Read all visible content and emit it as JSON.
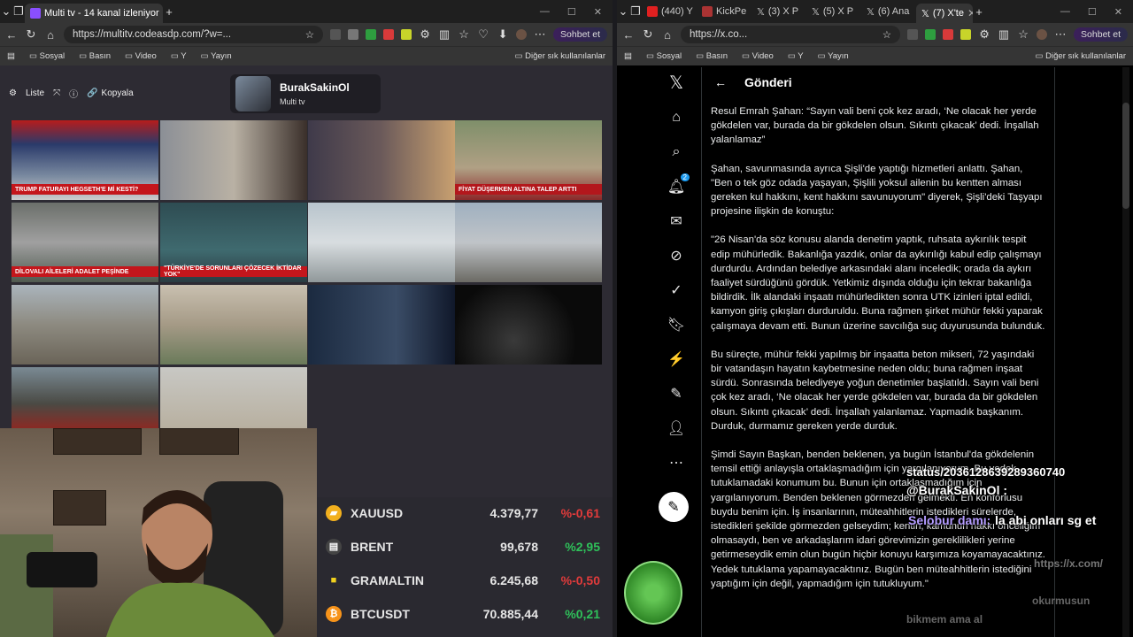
{
  "left_window": {
    "tab_title": "Multi tv - 14 kanal izleniyor",
    "url": "https://multitv.codeasdp.com/?w=...",
    "chat_label": "Sohbet et",
    "bookmarks": [
      "Sosyal",
      "Basın",
      "Video",
      "Y",
      "Yayın"
    ],
    "other_bookmarks": "Diğer sık kullanılanlar",
    "controls": {
      "list": "Liste",
      "copy": "Kopyala"
    },
    "channel": {
      "name": "BurakSakinOl",
      "subtitle": "Multi tv"
    },
    "tickers": {
      "trump": "TRUMP FATURAYI HEGSETH'E Mİ KESTİ?",
      "altin": "FİYAT DÜŞERKEN ALTINA TALEP ARTTI",
      "diloval": "DİLOVALI AİLELERİ ADALET PEŞİNDE",
      "ozel": "\"TÜRKİYE'DE SORUNLARI ÇÖZECEK İKTİDAR YOK\""
    }
  },
  "market": [
    {
      "symbol": "XAUUSD",
      "price": "4.379,77",
      "change": "%-0,61",
      "dir": "down",
      "color": "#f2b01e"
    },
    {
      "symbol": "BRENT",
      "price": "99,678",
      "change": "%2,95",
      "dir": "up",
      "color": "#dddddd"
    },
    {
      "symbol": "GRAMALTIN",
      "price": "6.245,68",
      "change": "%-0,50",
      "dir": "down",
      "color": "#f2d21e"
    },
    {
      "symbol": "BTCUSDT",
      "price": "70.885,44",
      "change": "%0,21",
      "dir": "up",
      "color": "#f7931a"
    }
  ],
  "right_window": {
    "tabs": [
      "(440) Y",
      "KickPe",
      "(3) X P",
      "(5) X P",
      "(6) Ana",
      "(7) X'te"
    ],
    "url": "https://x.co...",
    "chat_label": "Sohbet et",
    "bookmarks": [
      "Sosyal",
      "Basın",
      "Video",
      "Y",
      "Yayın"
    ],
    "other_bookmarks": "Diğer sık kullanılanlar",
    "post_header": "Gönderi",
    "paragraphs": [
      "Resul Emrah Şahan: “Sayın vali beni çok kez aradı, ‘Ne olacak her yerde gökdelen var, burada da bir gökdelen olsun. Sıkıntı çıkacak’ dedi. İnşallah yalanlamaz”",
      "Şahan, savunmasında ayrıca Şişli'de yaptığı hizmetleri anlattı. Şahan, \"Ben o tek göz odada yaşayan, Şişlili yoksul ailenin bu kentten alması gereken kul hakkını, kent hakkını savunuyorum\" diyerek, Şişli'deki Taşyapı projesine ilişkin de konuştu:",
      "\"26 Nisan'da söz konusu alanda denetim yaptık, ruhsata aykırılık tespit edip mühürledik. Bakanlığa yazdık, onlar da aykırılığı kabul edip çalışmayı durdurdu. Ardından belediye arkasındaki alanı inceledik; orada da aykırı faaliyet sürdüğünü gördük. Yetkimiz dışında olduğu için tekrar bakanlığa bildirdik. İlk alandaki inşaatı mühürledikten sonra UTK izinleri iptal edildi, kamyon giriş çıkışları durduruldu. Buna rağmen şirket mühür fekki yaparak çalışmaya devam etti. Bunun üzerine savcılığa suç duyurusunda bulunduk.",
      "Bu süreçte, mühür fekki yapılmış bir inşaatta beton mikseri, 72 yaşındaki bir vatandaşın hayatın kaybetmesine neden oldu; buna rağmen inşaat sürdü. Sonrasında belediyeye yoğun denetimler başlatıldı. Sayın vali beni çok kez aradı, ‘Ne olacak her yerde gökdelen var, burada da bir gökdelen olsun. Sıkıntı çıkacak’ dedi. İnşallah yalanlamaz. Yapmadık başkanım. Durduk, durmamız gereken yerde durduk.",
      "Şimdi Sayın Başkan, benden beklenen, ya bugün İstanbul'da gökdelenin temsil ettiği anlayışla ortaklaşmadığım için yargılanıyorum. Bu yedek tutuklamadaki konumum bu. Bunun için ortaklaşmadığım için yargılanıyorum. Benden beklenen görmezden gelmekti. En konforlusu buydu benim için. İş insanlarının, müteahhitlerin istedikleri sürelerde, istedikleri şekilde görmezden gelseydim; kentin, kamunun hakkı önceliğim olmasaydı, ben ve arkadaşlarım idari görevimizin gereklilikleri yerine getirmeseydik emin olun bugün hiçbir konuyu karşımıza koyamayacaktınız. Yedek tutuklama yapamayacaktınız. Bugün ben müteahhitlerin istediğini yaptığım için değil, yapmadığım için tutukluyum.\""
    ]
  },
  "overlay": {
    "status_line": "status/2036128639289360740",
    "mention": "@BurakSakinOl :",
    "user": "Selobur damı:",
    "message": "la abi onları sg et",
    "faded1": "https://x.com/",
    "faded2": "okurmusun",
    "faded3": "bikmem ama al"
  },
  "notification_count": "2"
}
